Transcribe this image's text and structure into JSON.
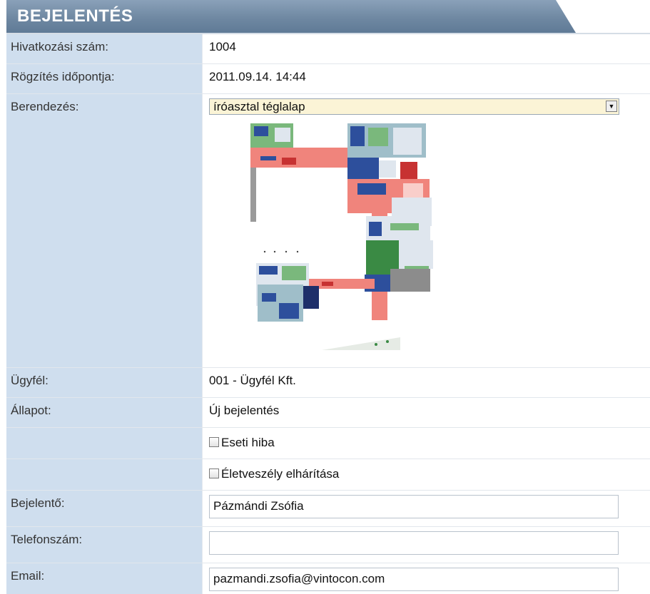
{
  "header": {
    "title": "BEJELENTÉS"
  },
  "form": {
    "ref_label": "Hivatkozási szám:",
    "ref_value": "1004",
    "time_label": "Rögzítés időpontja:",
    "time_value": "2011.09.14. 14:44",
    "equipment_label": "Berendezés:",
    "equipment_selected": "íróasztal téglalap",
    "client_label": "Ügyfél:",
    "client_value": "001 - Ügyfél Kft.",
    "status_label": "Állapot:",
    "status_value": "Új bejelentés",
    "incidental_label": "Eseti hiba",
    "incidental_checked": false,
    "danger_label": "Életveszély elhárítása",
    "danger_checked": false,
    "reporter_label": "Bejelentő:",
    "reporter_value": "Pázmándi Zsófia",
    "phone_label": "Telefonszám:",
    "phone_value": "",
    "email_label": "Email:",
    "email_value": "pazmandi.zsofia@vintocon.com"
  },
  "colors": {
    "header_bg": "#7890a9",
    "label_bg": "#cfdeee",
    "select_bg": "#fbf4d6",
    "plan_red": "#f0847c",
    "plan_green": "#7ab87c",
    "plan_blue": "#2d4f9c"
  }
}
